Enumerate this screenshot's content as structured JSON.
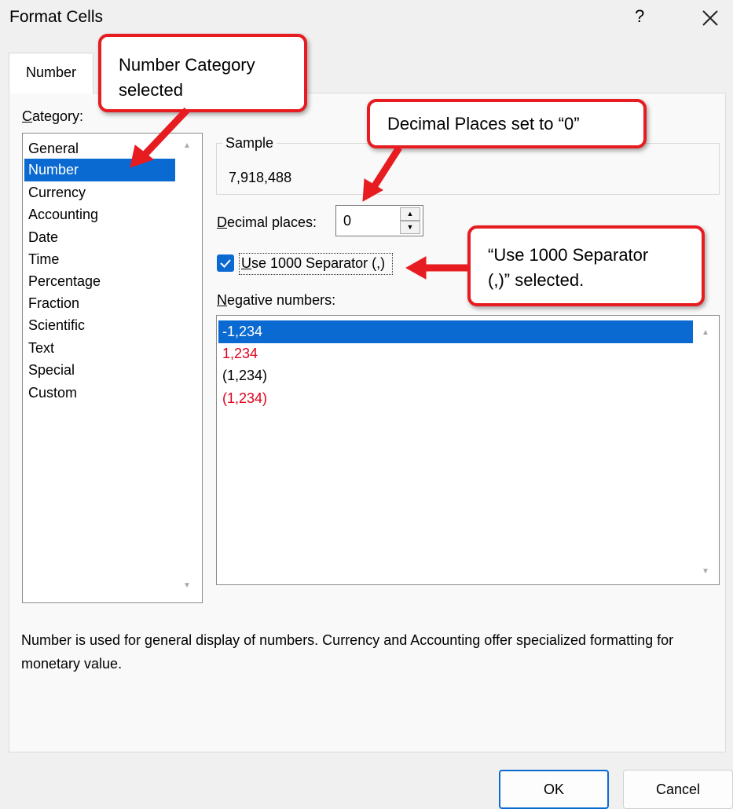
{
  "window": {
    "title": "Format Cells",
    "help_glyph": "?",
    "close_glyph": "×"
  },
  "tabs": [
    "Number"
  ],
  "category": {
    "label_underlined": "C",
    "label_rest": "ategory:",
    "items": [
      "General",
      "Number",
      "Currency",
      "Accounting",
      "Date",
      "Time",
      "Percentage",
      "Fraction",
      "Scientific",
      "Text",
      "Special",
      "Custom"
    ],
    "selected": "Number"
  },
  "sample": {
    "label": "Sample",
    "value": "7,918,488"
  },
  "decimal_places": {
    "label_underlined": "D",
    "label_rest": "ecimal places:",
    "value": "0"
  },
  "separator": {
    "label_underlined": "U",
    "label_rest": "se 1000 Separator (,)",
    "checked": true
  },
  "negative_numbers": {
    "label_underlined": "N",
    "label_rest": "egative numbers:",
    "items": [
      {
        "text": "-1,234",
        "color": "#000000"
      },
      {
        "text": "1,234",
        "color": "#e0001a"
      },
      {
        "text": "(1,234)",
        "color": "#000000"
      },
      {
        "text": "(1,234)",
        "color": "#e0001a"
      }
    ],
    "selected_index": 0
  },
  "description": "Number is used for general display of numbers.  Currency and Accounting offer specialized formatting for monetary value.",
  "buttons": {
    "ok": "OK",
    "cancel": "Cancel"
  },
  "annotations": {
    "category_callout_line1": "Number Category",
    "category_callout_line2": "selected",
    "decimal_callout": "Decimal Places set to “0”",
    "separator_callout_line1": "“Use 1000 Separator",
    "separator_callout_line2": "(,)” selected.",
    "callout_color": "#e61c20"
  },
  "colors": {
    "accent": "#0a6ad1",
    "negative_red": "#e0001a"
  }
}
